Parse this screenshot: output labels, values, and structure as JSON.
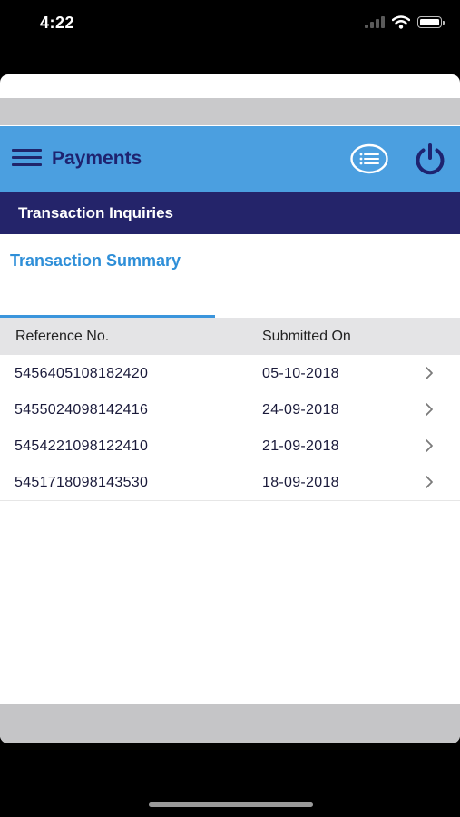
{
  "status_bar": {
    "time": "4:22"
  },
  "header": {
    "title": "Payments",
    "menu_icon": "hamburger-menu-icon",
    "list_icon": "list-icon",
    "power_icon": "power-icon"
  },
  "section": {
    "title": "Transaction Inquiries"
  },
  "tabs": [
    {
      "label": "Transaction Summary",
      "active": true
    }
  ],
  "table": {
    "columns": [
      "Reference No.",
      "Submitted On"
    ],
    "rows": [
      {
        "ref": "5456405108182420",
        "date": "05-10-2018"
      },
      {
        "ref": "5455024098142416",
        "date": "24-09-2018"
      },
      {
        "ref": "5454221098122410",
        "date": "21-09-2018"
      },
      {
        "ref": "5451718098143530",
        "date": "18-09-2018"
      }
    ]
  },
  "colors": {
    "header_bg": "#4b9fe0",
    "section_bg": "#24246a",
    "accent": "#2f8fd8",
    "title_text": "#1e2370"
  }
}
